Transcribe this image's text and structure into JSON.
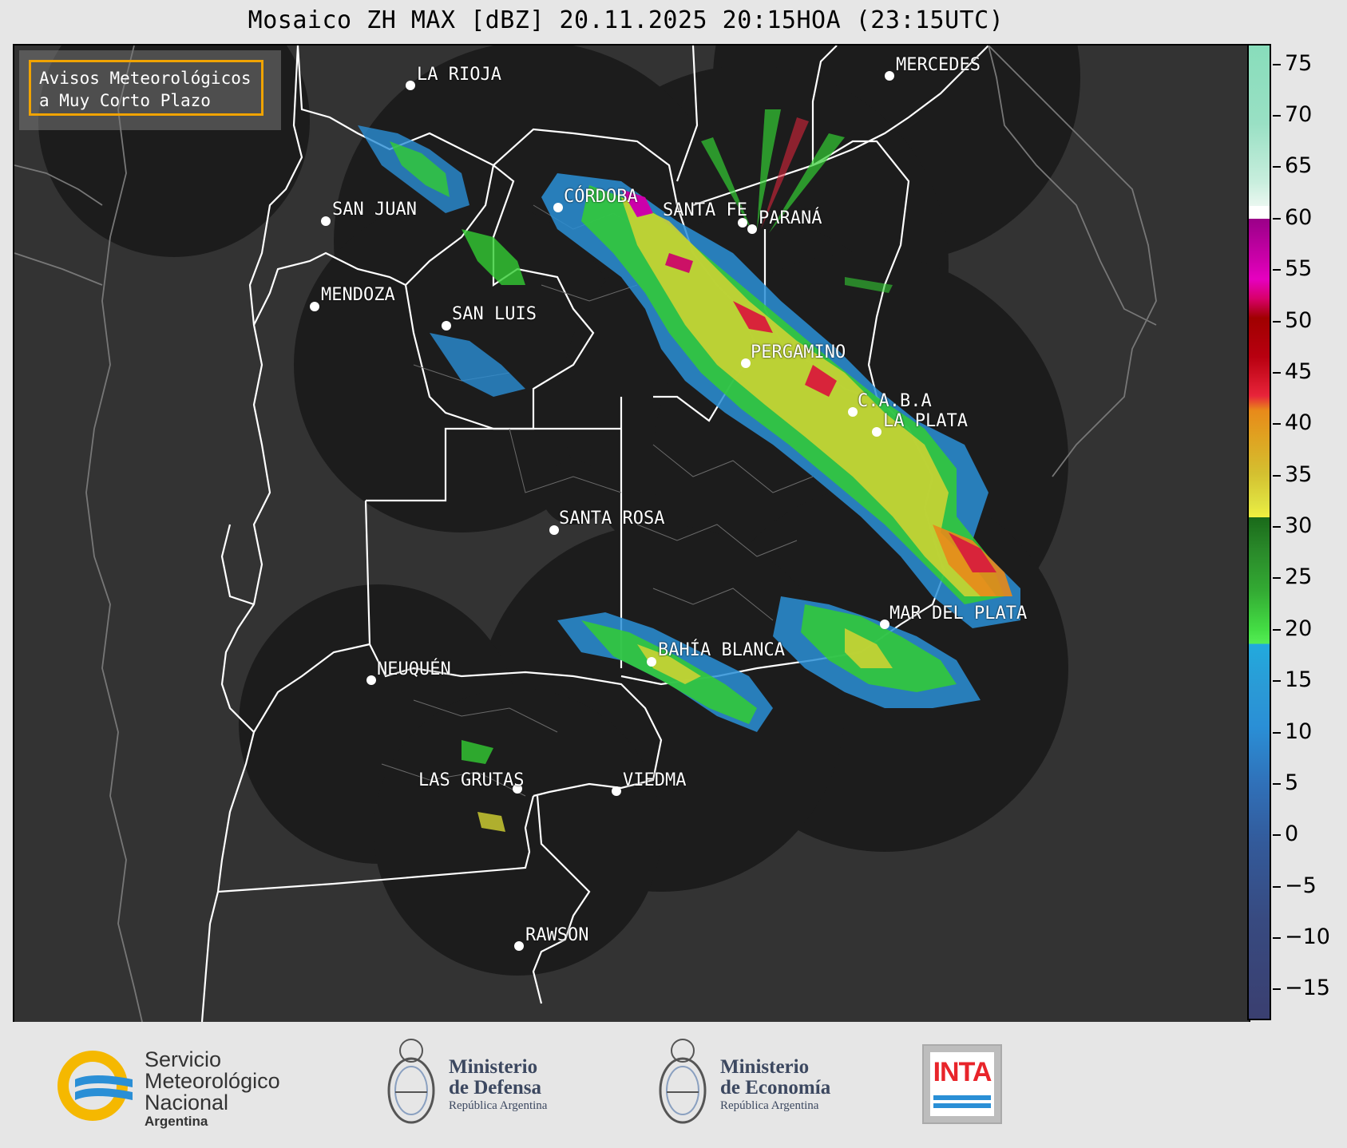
{
  "title": "Mosaico ZH MAX [dBZ] 20.11.2025 20:15HOA (23:15UTC)",
  "avisos": {
    "line1": "Avisos Meteorológicos",
    "line2": "a Muy Corto Plazo",
    "border_color": "#f0a300"
  },
  "cities": [
    {
      "name": "LA RIOJA"
    },
    {
      "name": "MERCEDES"
    },
    {
      "name": "SAN JUAN"
    },
    {
      "name": "CÓRDOBA"
    },
    {
      "name": "SANTA FE"
    },
    {
      "name": "PARANÁ"
    },
    {
      "name": "MENDOZA"
    },
    {
      "name": "SAN LUIS"
    },
    {
      "name": "PERGAMINO"
    },
    {
      "name": "C.A.B.A"
    },
    {
      "name": "LA PLATA"
    },
    {
      "name": "SANTA ROSA"
    },
    {
      "name": "MAR DEL PLATA"
    },
    {
      "name": "BAHÍA BLANCA"
    },
    {
      "name": "NEUQUÉN"
    },
    {
      "name": "LAS GRUTAS"
    },
    {
      "name": "VIEDMA"
    },
    {
      "name": "RAWSON"
    }
  ],
  "colorbar": {
    "min": -18,
    "max": 77,
    "ticks": [
      "75",
      "70",
      "65",
      "60",
      "55",
      "50",
      "45",
      "40",
      "35",
      "30",
      "25",
      "20",
      "15",
      "10",
      "5",
      "0",
      "−5",
      "−10",
      "−15"
    ],
    "tick_values": [
      75,
      70,
      65,
      60,
      55,
      50,
      45,
      40,
      35,
      30,
      25,
      20,
      15,
      10,
      5,
      0,
      -5,
      -10,
      -15
    ]
  },
  "logos": {
    "smn": {
      "line1": "Servicio",
      "line2": "Meteorológico",
      "line3": "Nacional",
      "line4": "Argentina"
    },
    "defensa": {
      "line1": "Ministerio",
      "line2": "de Defensa",
      "line3": "República Argentina"
    },
    "economia": {
      "line1": "Ministerio",
      "line2": "de Economía",
      "line3": "República Argentina"
    },
    "inta": {
      "text": "INTA"
    }
  },
  "colors": {
    "map_bg": "#333333",
    "radar_bg": "#1c1c1c",
    "border_white": "#ffffff",
    "inta_red": "#e8242a",
    "smn_blue": "#2a8fd6",
    "smn_yellow": "#f5b800"
  }
}
